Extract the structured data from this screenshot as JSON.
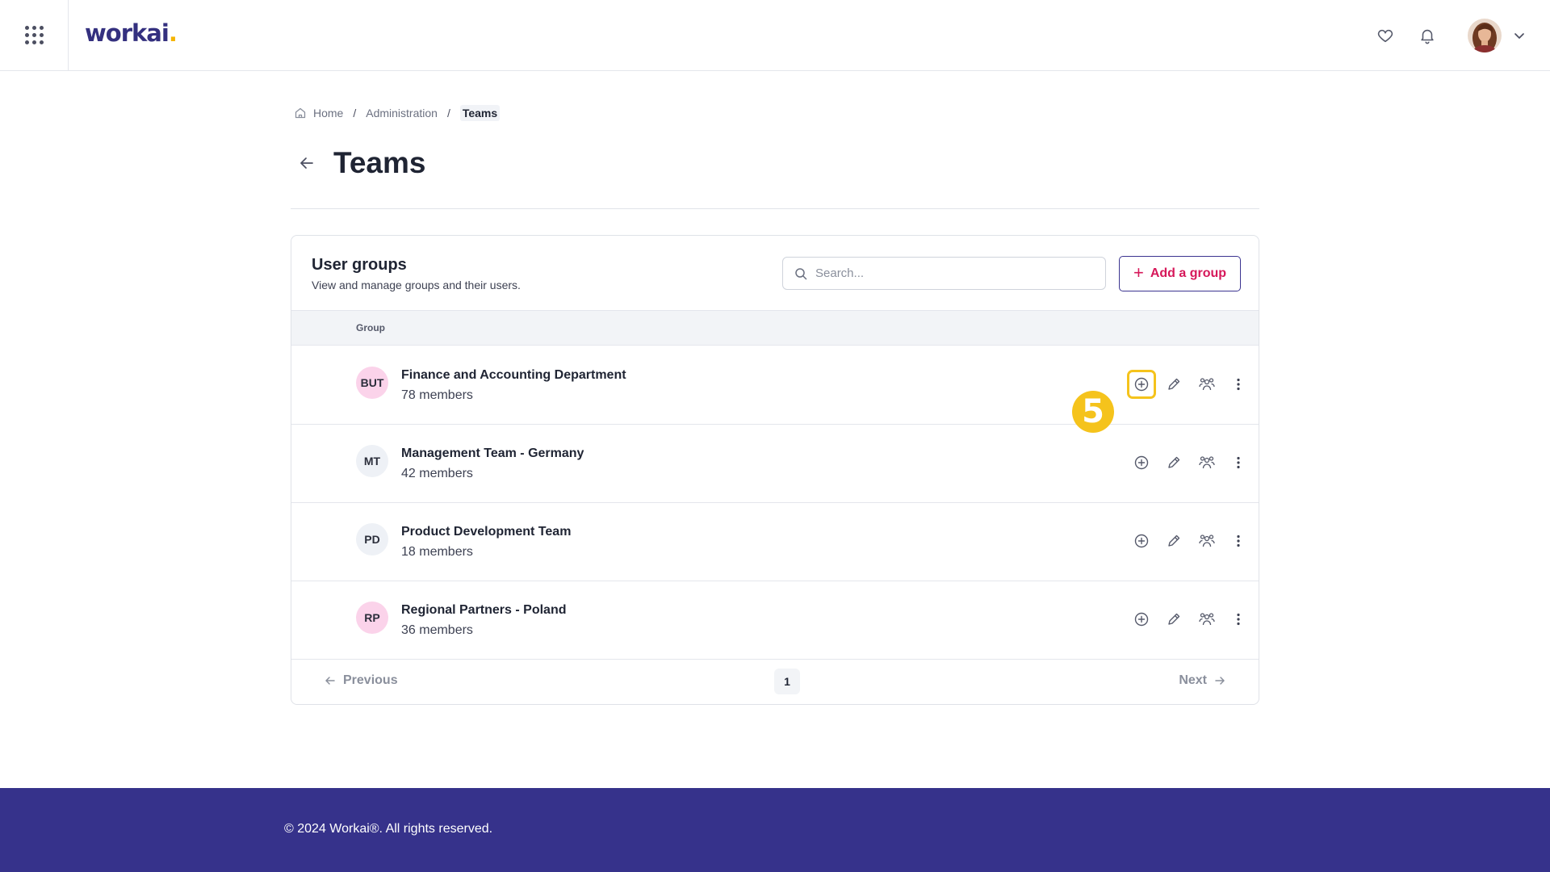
{
  "app": {
    "logo_text": "workai",
    "logo_dot": ".",
    "brand_color": "#34307f",
    "accent_color": "#d6185a"
  },
  "topbar": {
    "icons": [
      "apps-grid-icon",
      "heart-icon",
      "bell-icon",
      "user-avatar",
      "chevron-down-icon"
    ]
  },
  "breadcrumb": {
    "home": "Home",
    "sep1": "/",
    "admin": "Administration",
    "sep2": "/",
    "current": "Teams"
  },
  "page": {
    "title": "Teams"
  },
  "card": {
    "title": "User groups",
    "subtitle": "View and manage groups and their users.",
    "search_placeholder": "Search...",
    "add_plus": "+",
    "add_label": "Add a group",
    "column_group": "Group"
  },
  "groups": [
    {
      "initials": "BUT",
      "name": "Finance and Accounting Department",
      "members": "78 members",
      "badge_color": "#fbd3ea"
    },
    {
      "initials": "MT",
      "name": "Management Team - Germany",
      "members": "42 members",
      "badge_color": "#eef1f6"
    },
    {
      "initials": "PD",
      "name": "Product Development Team",
      "members": "18 members",
      "badge_color": "#eef1f6"
    },
    {
      "initials": "RP",
      "name": "Regional Partners - Poland",
      "members": "36 members",
      "badge_color": "#fbd3ea"
    }
  ],
  "step_marker": "5",
  "pagination": {
    "previous": "Previous",
    "page": "1",
    "next": "Next"
  },
  "footer": {
    "copyright": "© 2024 Workai®. All rights reserved."
  }
}
